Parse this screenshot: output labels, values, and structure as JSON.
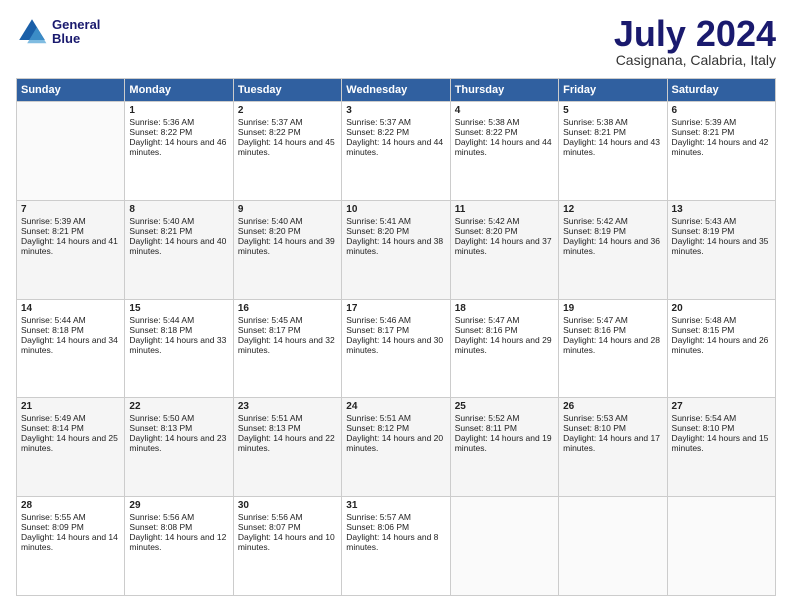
{
  "logo": {
    "line1": "General",
    "line2": "Blue"
  },
  "title": "July 2024",
  "subtitle": "Casignana, Calabria, Italy",
  "days_of_week": [
    "Sunday",
    "Monday",
    "Tuesday",
    "Wednesday",
    "Thursday",
    "Friday",
    "Saturday"
  ],
  "weeks": [
    [
      {
        "day": "",
        "sunrise": "",
        "sunset": "",
        "daylight": ""
      },
      {
        "day": "1",
        "sunrise": "Sunrise: 5:36 AM",
        "sunset": "Sunset: 8:22 PM",
        "daylight": "Daylight: 14 hours and 46 minutes."
      },
      {
        "day": "2",
        "sunrise": "Sunrise: 5:37 AM",
        "sunset": "Sunset: 8:22 PM",
        "daylight": "Daylight: 14 hours and 45 minutes."
      },
      {
        "day": "3",
        "sunrise": "Sunrise: 5:37 AM",
        "sunset": "Sunset: 8:22 PM",
        "daylight": "Daylight: 14 hours and 44 minutes."
      },
      {
        "day": "4",
        "sunrise": "Sunrise: 5:38 AM",
        "sunset": "Sunset: 8:22 PM",
        "daylight": "Daylight: 14 hours and 44 minutes."
      },
      {
        "day": "5",
        "sunrise": "Sunrise: 5:38 AM",
        "sunset": "Sunset: 8:21 PM",
        "daylight": "Daylight: 14 hours and 43 minutes."
      },
      {
        "day": "6",
        "sunrise": "Sunrise: 5:39 AM",
        "sunset": "Sunset: 8:21 PM",
        "daylight": "Daylight: 14 hours and 42 minutes."
      }
    ],
    [
      {
        "day": "7",
        "sunrise": "Sunrise: 5:39 AM",
        "sunset": "Sunset: 8:21 PM",
        "daylight": "Daylight: 14 hours and 41 minutes."
      },
      {
        "day": "8",
        "sunrise": "Sunrise: 5:40 AM",
        "sunset": "Sunset: 8:21 PM",
        "daylight": "Daylight: 14 hours and 40 minutes."
      },
      {
        "day": "9",
        "sunrise": "Sunrise: 5:40 AM",
        "sunset": "Sunset: 8:20 PM",
        "daylight": "Daylight: 14 hours and 39 minutes."
      },
      {
        "day": "10",
        "sunrise": "Sunrise: 5:41 AM",
        "sunset": "Sunset: 8:20 PM",
        "daylight": "Daylight: 14 hours and 38 minutes."
      },
      {
        "day": "11",
        "sunrise": "Sunrise: 5:42 AM",
        "sunset": "Sunset: 8:20 PM",
        "daylight": "Daylight: 14 hours and 37 minutes."
      },
      {
        "day": "12",
        "sunrise": "Sunrise: 5:42 AM",
        "sunset": "Sunset: 8:19 PM",
        "daylight": "Daylight: 14 hours and 36 minutes."
      },
      {
        "day": "13",
        "sunrise": "Sunrise: 5:43 AM",
        "sunset": "Sunset: 8:19 PM",
        "daylight": "Daylight: 14 hours and 35 minutes."
      }
    ],
    [
      {
        "day": "14",
        "sunrise": "Sunrise: 5:44 AM",
        "sunset": "Sunset: 8:18 PM",
        "daylight": "Daylight: 14 hours and 34 minutes."
      },
      {
        "day": "15",
        "sunrise": "Sunrise: 5:44 AM",
        "sunset": "Sunset: 8:18 PM",
        "daylight": "Daylight: 14 hours and 33 minutes."
      },
      {
        "day": "16",
        "sunrise": "Sunrise: 5:45 AM",
        "sunset": "Sunset: 8:17 PM",
        "daylight": "Daylight: 14 hours and 32 minutes."
      },
      {
        "day": "17",
        "sunrise": "Sunrise: 5:46 AM",
        "sunset": "Sunset: 8:17 PM",
        "daylight": "Daylight: 14 hours and 30 minutes."
      },
      {
        "day": "18",
        "sunrise": "Sunrise: 5:47 AM",
        "sunset": "Sunset: 8:16 PM",
        "daylight": "Daylight: 14 hours and 29 minutes."
      },
      {
        "day": "19",
        "sunrise": "Sunrise: 5:47 AM",
        "sunset": "Sunset: 8:16 PM",
        "daylight": "Daylight: 14 hours and 28 minutes."
      },
      {
        "day": "20",
        "sunrise": "Sunrise: 5:48 AM",
        "sunset": "Sunset: 8:15 PM",
        "daylight": "Daylight: 14 hours and 26 minutes."
      }
    ],
    [
      {
        "day": "21",
        "sunrise": "Sunrise: 5:49 AM",
        "sunset": "Sunset: 8:14 PM",
        "daylight": "Daylight: 14 hours and 25 minutes."
      },
      {
        "day": "22",
        "sunrise": "Sunrise: 5:50 AM",
        "sunset": "Sunset: 8:13 PM",
        "daylight": "Daylight: 14 hours and 23 minutes."
      },
      {
        "day": "23",
        "sunrise": "Sunrise: 5:51 AM",
        "sunset": "Sunset: 8:13 PM",
        "daylight": "Daylight: 14 hours and 22 minutes."
      },
      {
        "day": "24",
        "sunrise": "Sunrise: 5:51 AM",
        "sunset": "Sunset: 8:12 PM",
        "daylight": "Daylight: 14 hours and 20 minutes."
      },
      {
        "day": "25",
        "sunrise": "Sunrise: 5:52 AM",
        "sunset": "Sunset: 8:11 PM",
        "daylight": "Daylight: 14 hours and 19 minutes."
      },
      {
        "day": "26",
        "sunrise": "Sunrise: 5:53 AM",
        "sunset": "Sunset: 8:10 PM",
        "daylight": "Daylight: 14 hours and 17 minutes."
      },
      {
        "day": "27",
        "sunrise": "Sunrise: 5:54 AM",
        "sunset": "Sunset: 8:10 PM",
        "daylight": "Daylight: 14 hours and 15 minutes."
      }
    ],
    [
      {
        "day": "28",
        "sunrise": "Sunrise: 5:55 AM",
        "sunset": "Sunset: 8:09 PM",
        "daylight": "Daylight: 14 hours and 14 minutes."
      },
      {
        "day": "29",
        "sunrise": "Sunrise: 5:56 AM",
        "sunset": "Sunset: 8:08 PM",
        "daylight": "Daylight: 14 hours and 12 minutes."
      },
      {
        "day": "30",
        "sunrise": "Sunrise: 5:56 AM",
        "sunset": "Sunset: 8:07 PM",
        "daylight": "Daylight: 14 hours and 10 minutes."
      },
      {
        "day": "31",
        "sunrise": "Sunrise: 5:57 AM",
        "sunset": "Sunset: 8:06 PM",
        "daylight": "Daylight: 14 hours and 8 minutes."
      },
      {
        "day": "",
        "sunrise": "",
        "sunset": "",
        "daylight": ""
      },
      {
        "day": "",
        "sunrise": "",
        "sunset": "",
        "daylight": ""
      },
      {
        "day": "",
        "sunrise": "",
        "sunset": "",
        "daylight": ""
      }
    ]
  ]
}
